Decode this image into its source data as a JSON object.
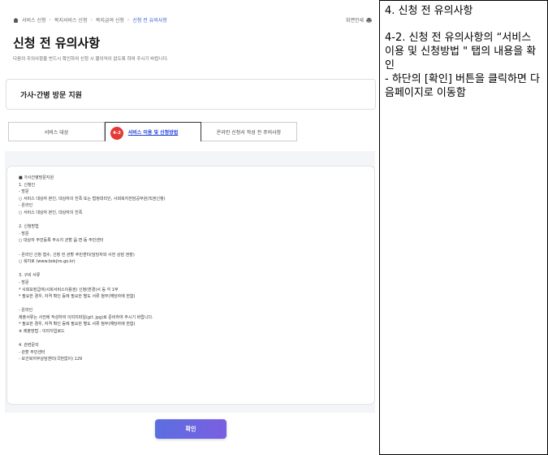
{
  "breadcrumb": {
    "items": [
      "서비스 신청",
      "복지서비스 신청",
      "복지급여 신청",
      "신청 전 유의사항"
    ]
  },
  "print_label": "화면인쇄",
  "page_title": "신청 전 유의사항",
  "description": "다음의 주의사항을 반드시 확인하여 신청 시 불이익이 없도록 하여 주시기 바랍니다.",
  "service_name": "가사·간병 방문 지원",
  "tabs": [
    {
      "label": "서비스 대상"
    },
    {
      "label": "서비스 이용 및 신청방법",
      "badge": "4-2"
    },
    {
      "label": "온라인 신청서 작성 전 주의사항"
    }
  ],
  "content_text": "■ 가사간병방문지원\n1. 신청인\n- 방문\n○ 서비스 대상자 본인, 대상자의 친족 또는 법정대리인, 사회복지전담공무원(직권신청)\n- 온라인\n○ 서비스 대상자 본인, 대상자의 친족\n\n2. 신청방법\n- 방문\n○ 대상자 주민등록 주소지 관할 읍·면·동 주민센터\n\n- 온라인 신청 접수, 신청 전 관할 주민센터(담당자와 사전 상담 권장)\n○ 복지로 (www.bokjiro.go.kr)\n\n3. 구비 서류\n- 방문\n* 사회보장급여(사회서비스이용권) 신청(변경)서 등 각 1부\n* 필요한 경우, 자격 확인 등에 필요한 별도 서류 첨부(해당자에 한함)\n\n- 온라인\n제출서류는 사전에 작성하여 이미지파일(gif, jpg)로 준비하여 주시기 바랍니다.\n* 필요한 경우, 자격 확인 등에 필요한 별도 서류 첨부(해당자에 한함)\n※ 제출방법 : 이미지업로드\n\n4. 관련문의\n- 관할 주민센터\n- 보건복지부상담센터(국번없이) 129",
  "confirm_label": "확인",
  "annotation": {
    "title": "4. 신청 전 유의사항",
    "body": "4-2. 신청 전 유의사항의 “서비스 이용 및 신청방법 \" 탭의 내용을 확인\n - 하단의 [확인] 버튼을 클릭하면 다음페이지로 이동함"
  },
  "icons": {
    "home": "home-icon",
    "print": "printer-icon"
  },
  "colors": {
    "accent": "#3b57d1",
    "badge": "#e53935",
    "button": "#6a67e0"
  }
}
